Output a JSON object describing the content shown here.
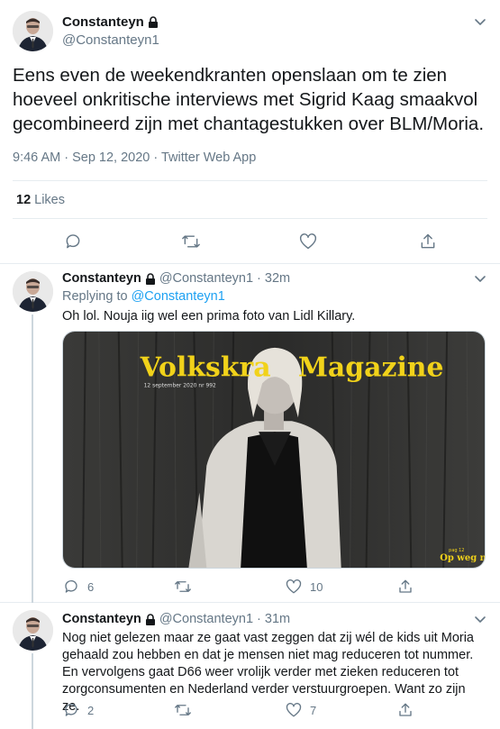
{
  "main_tweet": {
    "name": "Constanteyn",
    "handle": "@Constanteyn1",
    "text": "Eens even de weekendkranten openslaan om te zien hoeveel onkritische interviews met Sigrid Kaag smaakvol gecombineerd zijn met chantagestukken over BLM/Moria.",
    "meta": "9:46 AM · Sep 12, 2020 · Twitter Web App",
    "likes_count": "12",
    "likes_label": "Likes"
  },
  "replies": [
    {
      "name": "Constanteyn",
      "handle": "@Constanteyn1",
      "sep": "·",
      "time": "32m",
      "replying_prefix": "Replying to",
      "replying_to": "@Constanteyn1",
      "text": "Oh lol. Nouja iig wel een prima foto van Lidl Killary.",
      "media": {
        "masthead": "Volkskrant Magazine",
        "date_line": "12 september 2020 nr 992",
        "corner_small": "pag 12",
        "corner_text": "Op weg naar"
      },
      "reply_count": "6",
      "like_count": "10"
    },
    {
      "name": "Constanteyn",
      "handle": "@Constanteyn1",
      "sep": "·",
      "time": "31m",
      "text": "Nog niet gelezen maar ze gaat vast zeggen dat zij wél de kids uit Moria gehaald zou hebben en dat je mensen niet mag reduceren tot nummer. En vervolgens gaat D66 weer vrolijk verder met zieken reduceren tot zorgconsumenten en Nederland verder verstuurgroepen. Want zo zijn ze.",
      "reply_count": "2",
      "like_count": "7"
    }
  ],
  "colors": {
    "accent": "#1da1f2",
    "secondary_text": "#657786",
    "border": "#e6ecf0",
    "masthead_yellow": "#f1d21a"
  },
  "icons": [
    "lock-icon",
    "chevron-down-icon",
    "reply-icon",
    "retweet-icon",
    "like-icon",
    "share-icon"
  ]
}
